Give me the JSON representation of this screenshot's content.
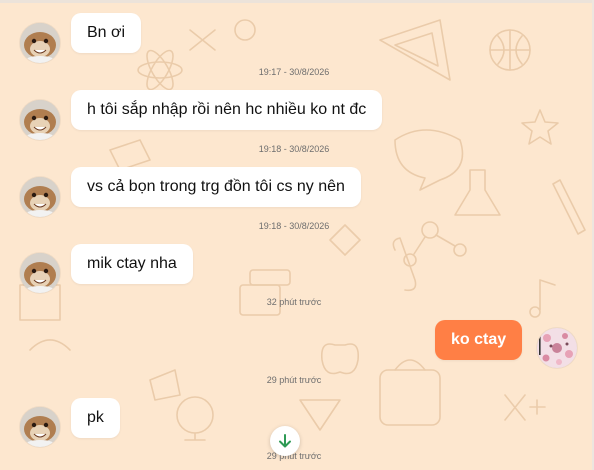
{
  "messages": [
    {
      "text": "Bn ơi",
      "time": "19:17 - 30/8/2026"
    },
    {
      "text": "h tôi sắp nhập rồi nên hc nhiều ko nt đc",
      "time": "19:18 - 30/8/2026"
    },
    {
      "text": "vs cả bọn trong trg đồn tôi cs ny nên",
      "time": "19:18 - 30/8/2026"
    },
    {
      "text": "mik ctay nha",
      "time": "32 phút trước"
    },
    {
      "text": "ko ctay",
      "time": "29 phút trước"
    },
    {
      "text": "pk",
      "time": "29 phút trước"
    }
  ],
  "colors": {
    "background": "#fde7cf",
    "own_bubble": "#ff7f45",
    "other_bubble": "#ffffff",
    "scroll_arrow": "#2e9a55"
  },
  "icons": {
    "avatar_other": "hamster-avatar",
    "avatar_self": "floral-avatar",
    "scroll_down": "arrow-down-icon"
  }
}
